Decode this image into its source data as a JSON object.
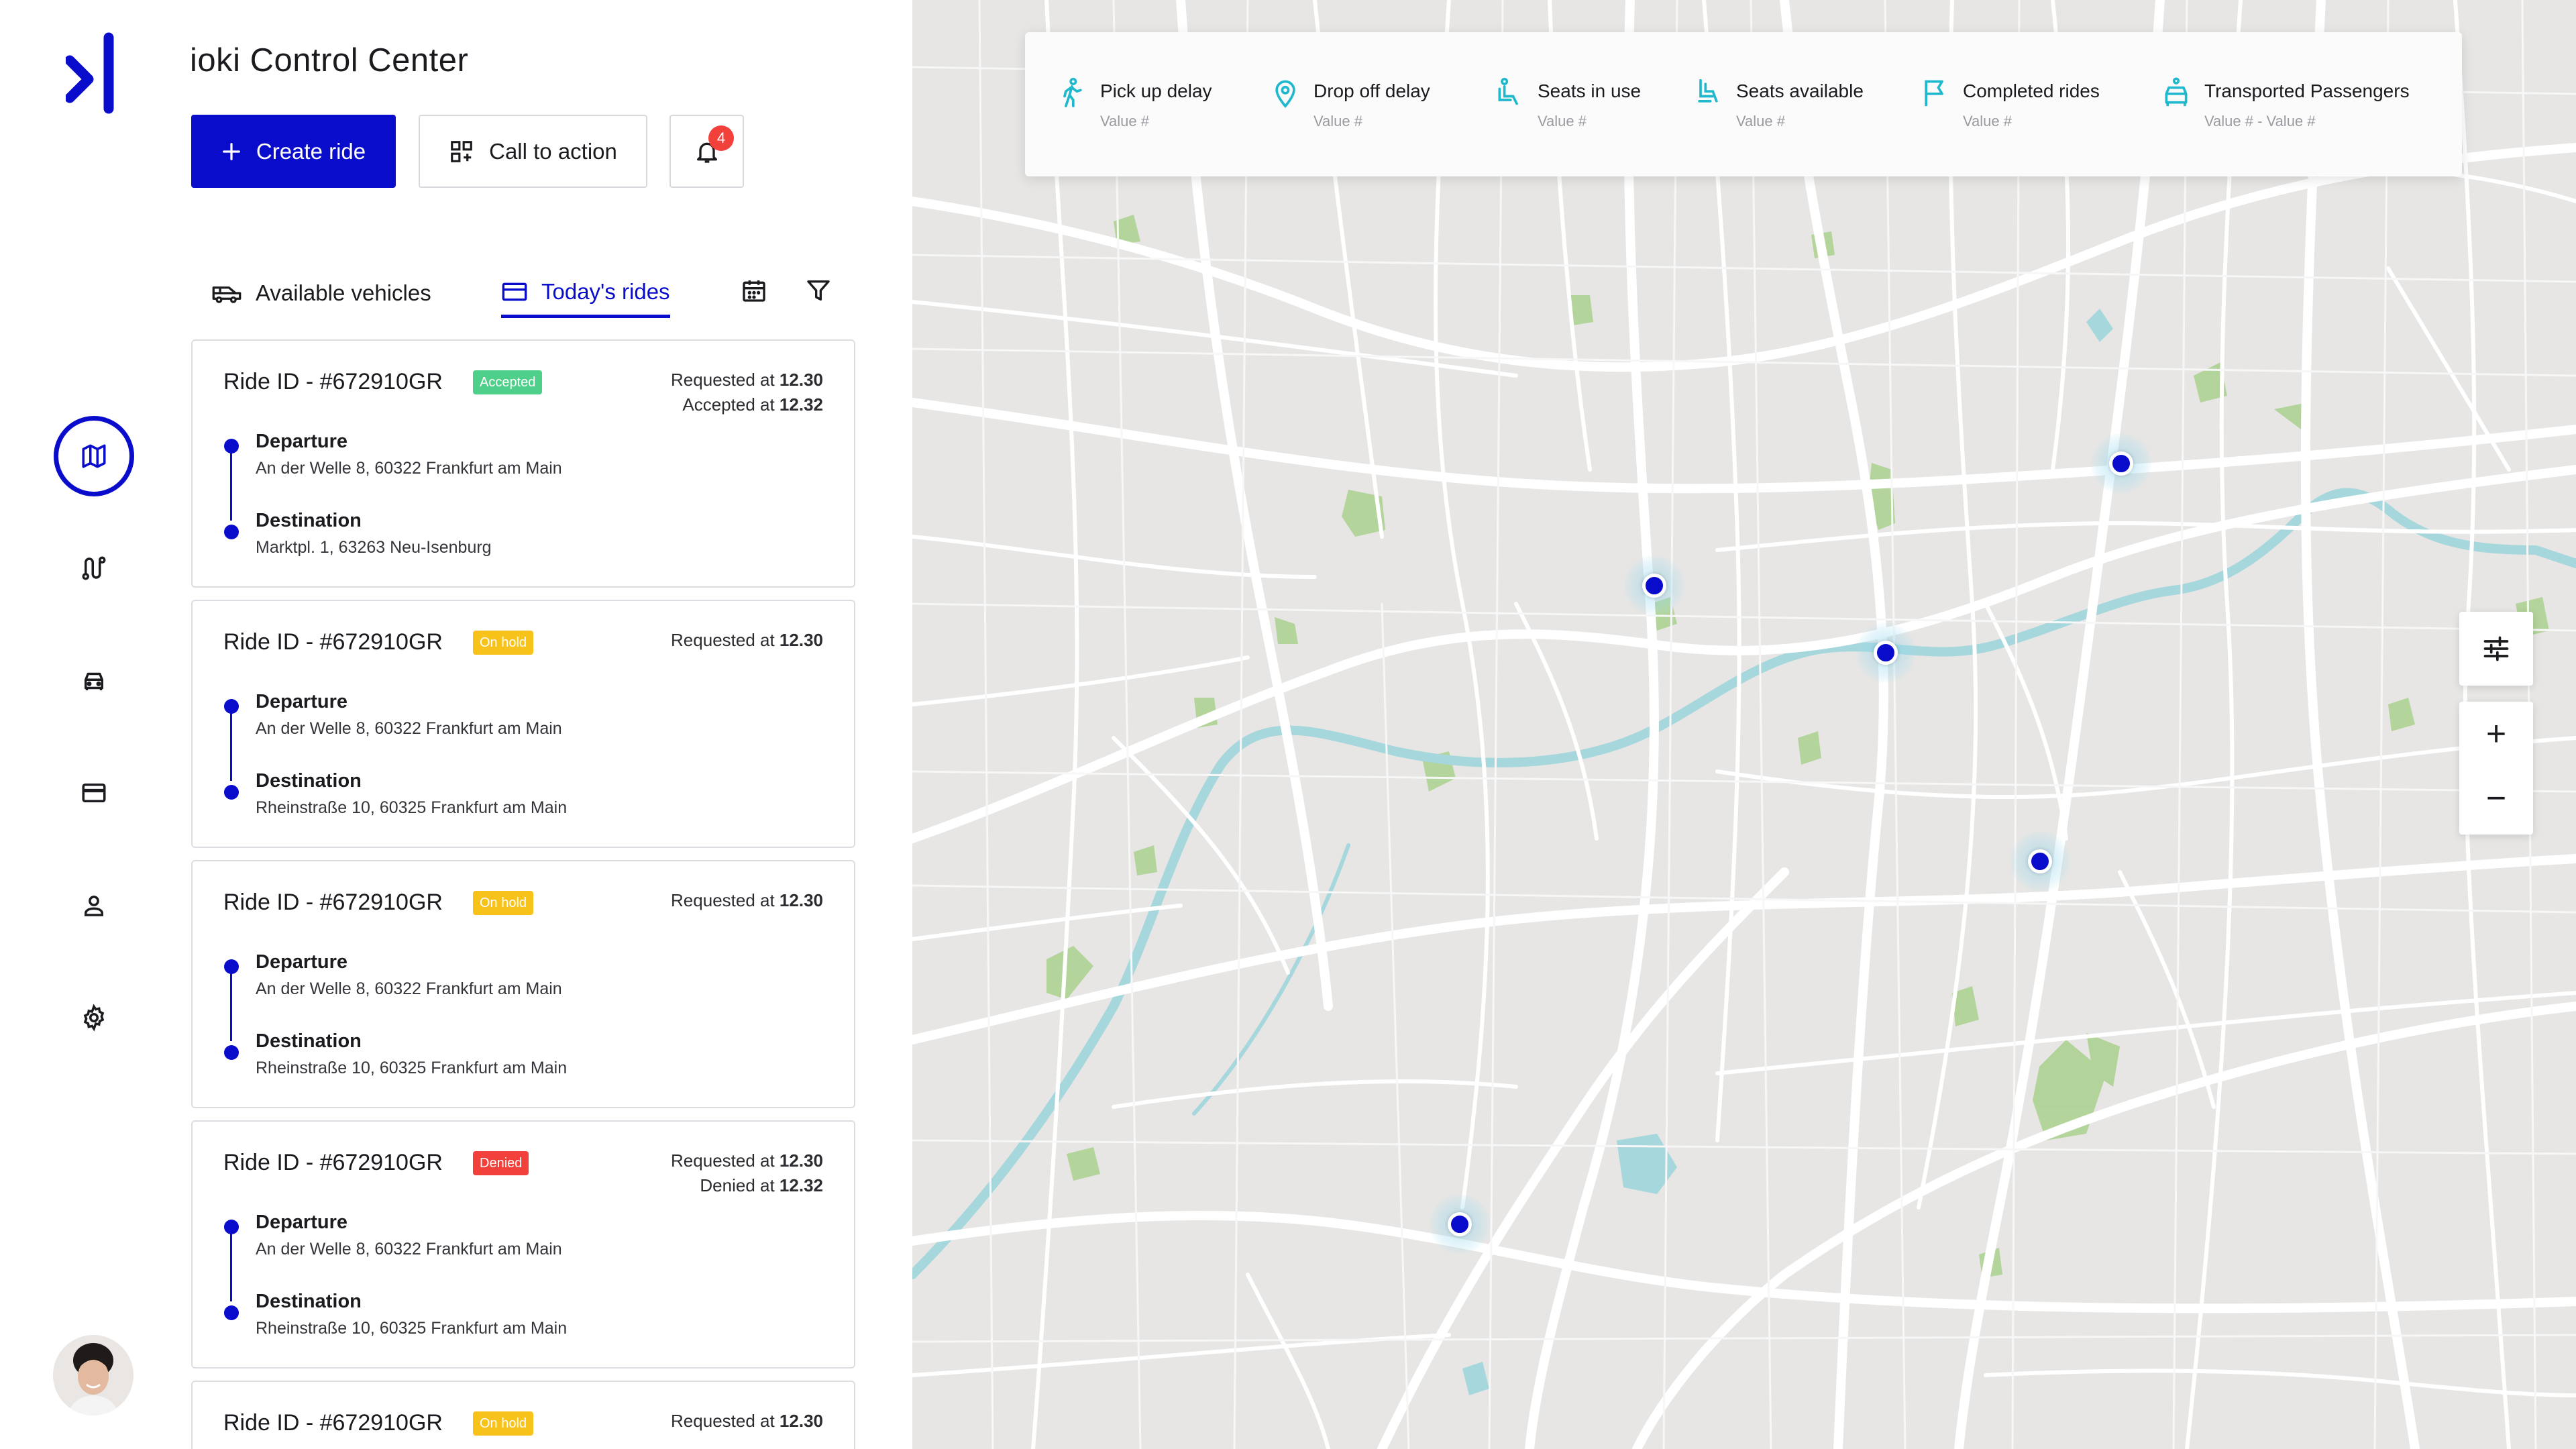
{
  "app": {
    "title": "ioki Control Center"
  },
  "colors": {
    "accent": "#0a0ccc",
    "accepted": "#4fd08a",
    "on_hold": "#f7c21a",
    "denied": "#f2413a",
    "notification": "#f2413a",
    "metric_icon": "#1fb8cc"
  },
  "sidebar": {
    "items": [
      {
        "name": "map",
        "icon": "map-icon",
        "active": true
      },
      {
        "name": "routes",
        "icon": "route-icon",
        "active": false
      },
      {
        "name": "vehicles",
        "icon": "car-icon",
        "active": false
      },
      {
        "name": "payments",
        "icon": "credit-card-icon",
        "active": false
      },
      {
        "name": "users",
        "icon": "user-icon",
        "active": false
      },
      {
        "name": "settings",
        "icon": "gear-icon",
        "active": false
      }
    ]
  },
  "toolbar": {
    "create_label": "Create ride",
    "cta_label": "Call to action",
    "notification_count": "4"
  },
  "tabs": {
    "vehicles_label": "Available vehicles",
    "rides_label": "Today's rides",
    "active": "rides"
  },
  "rides": [
    {
      "id": "Ride ID - #672910GR",
      "status": "Accepted",
      "requested_prefix": "Requested at ",
      "requested_time": "12.30",
      "second_prefix": "Accepted at ",
      "second_time": "12.32",
      "departure_label": "Departure",
      "departure": "An der Welle 8, 60322 Frankfurt am Main",
      "destination_label": "Destination",
      "destination": "Marktpl. 1, 63263 Neu-Isenburg"
    },
    {
      "id": "Ride ID - #672910GR",
      "status": "On hold",
      "requested_prefix": "Requested at ",
      "requested_time": "12.30",
      "departure_label": "Departure",
      "departure": "An der Welle 8, 60322 Frankfurt am Main",
      "destination_label": "Destination",
      "destination": "Rheinstraße 10, 60325 Frankfurt am Main"
    },
    {
      "id": "Ride ID - #672910GR",
      "status": "On hold",
      "requested_prefix": "Requested at ",
      "requested_time": "12.30",
      "departure_label": "Departure",
      "departure": "An der Welle 8, 60322 Frankfurt am Main",
      "destination_label": "Destination",
      "destination": "Rheinstraße 10, 60325 Frankfurt am Main"
    },
    {
      "id": "Ride ID - #672910GR",
      "status": "Denied",
      "requested_prefix": "Requested at ",
      "requested_time": "12.30",
      "second_prefix": "Denied at ",
      "second_time": "12.32",
      "departure_label": "Departure",
      "departure": "An der Welle 8, 60322 Frankfurt am Main",
      "destination_label": "Destination",
      "destination": "Rheinstraße 10, 60325 Frankfurt am Main"
    },
    {
      "id": "Ride ID - #672910GR",
      "status": "On hold",
      "requested_prefix": "Requested at ",
      "requested_time": "12.30"
    }
  ],
  "metrics": [
    {
      "label": "Pick up delay",
      "value": "Value #",
      "icon": "walking-person-icon"
    },
    {
      "label": "Drop off delay",
      "value": "Value #",
      "icon": "location-pin-icon"
    },
    {
      "label": "Seats in use",
      "value": "Value #",
      "icon": "seated-person-icon"
    },
    {
      "label": "Seats available",
      "value": "Value #",
      "icon": "seat-icon"
    },
    {
      "label": "Completed rides",
      "value": "Value #",
      "icon": "flag-icon"
    },
    {
      "label": "Transported Passengers",
      "value": "Value # - Value #",
      "icon": "car-passenger-icon"
    }
  ],
  "map_controls": {
    "filter_icon": "sliders-icon",
    "zoom_in": "+",
    "zoom_out": "−"
  }
}
